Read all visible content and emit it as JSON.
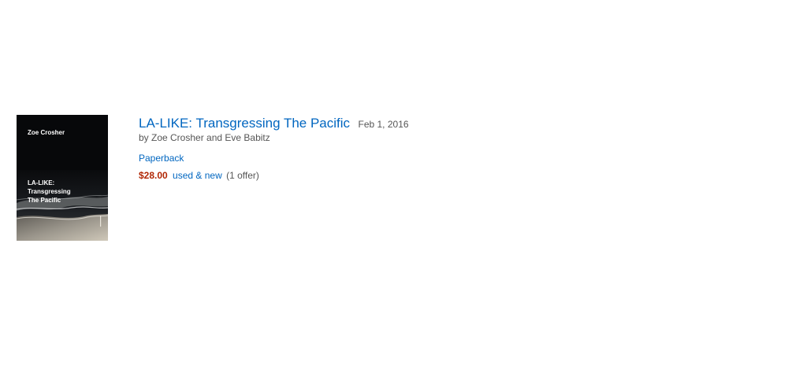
{
  "product": {
    "cover": {
      "author": "Zoe Crosher",
      "title_lines": [
        "LA-LIKE:",
        "Transgressing",
        "The Pacific"
      ]
    },
    "title": "LA-LIKE: Transgressing The Pacific",
    "date": "Feb 1, 2016",
    "byline": "by Zoe Crosher and Eve Babitz",
    "format": "Paperback",
    "price": "$28.00",
    "offers_link": "used & new",
    "offer_count": "(1 offer)"
  },
  "colors": {
    "link": "#0066c0",
    "price": "#b12704",
    "muted": "#555555",
    "cover_bg": "#07080a"
  }
}
